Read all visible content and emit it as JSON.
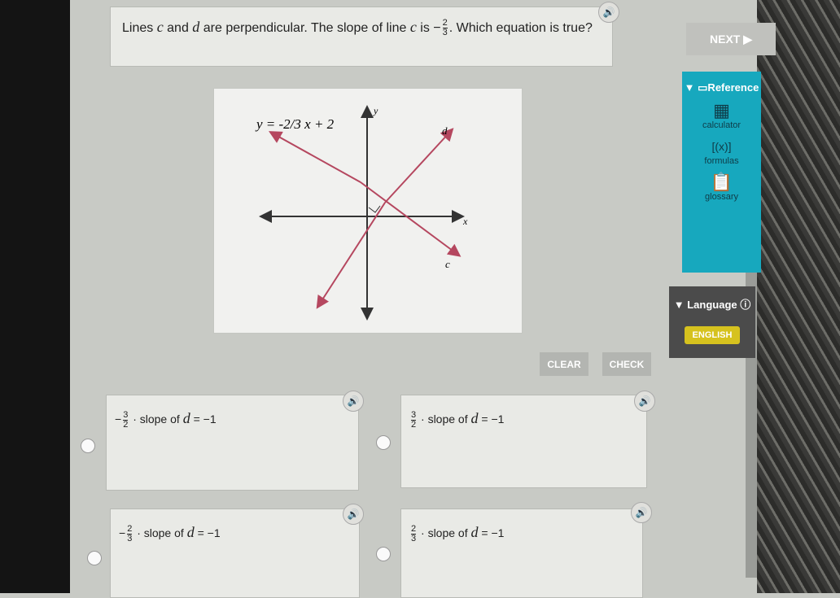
{
  "question": {
    "text_before": "Lines ",
    "var_c": "c",
    "and": " and ",
    "var_d": "d",
    "text_mid": " are perpendicular. The slope of line ",
    "var_c2": "c",
    "is": " is −",
    "slope_num": "2",
    "slope_den": "3",
    "text_after": ". Which equation is true?"
  },
  "nav": {
    "next_label": "NEXT ▶"
  },
  "reference": {
    "title": "▼ ▭Reference",
    "tools": [
      {
        "label": "calculator",
        "icon": "calculator-icon"
      },
      {
        "label": "formulas",
        "icon": "formulas-icon"
      },
      {
        "label": "glossary",
        "icon": "clipboard-icon"
      }
    ]
  },
  "language": {
    "title": "▼ Language ⓘ",
    "value": "ENGLISH"
  },
  "graph": {
    "equation": "y = -2/3 x + 2",
    "x_label": "x",
    "y_label": "y",
    "line_c": "c",
    "line_d": "d",
    "colors": {
      "lines": "#b5475f"
    }
  },
  "actions": {
    "clear": "CLEAR",
    "check": "CHECK"
  },
  "choices": [
    {
      "sign": "−",
      "num": "3",
      "den": "2",
      "text": " · slope of ",
      "var": "d",
      "eq": " = −1"
    },
    {
      "sign": "",
      "num": "3",
      "den": "2",
      "text": " · slope of ",
      "var": "d",
      "eq": " = −1"
    },
    {
      "sign": "−",
      "num": "2",
      "den": "3",
      "text": " · slope of ",
      "var": "d",
      "eq": " = −1"
    },
    {
      "sign": "",
      "num": "2",
      "den": "3",
      "text": " · slope of ",
      "var": "d",
      "eq": " = −1"
    }
  ],
  "colors": {
    "reference": "#17a8be",
    "language": "#4b4b4b",
    "english": "#d6c21e"
  }
}
